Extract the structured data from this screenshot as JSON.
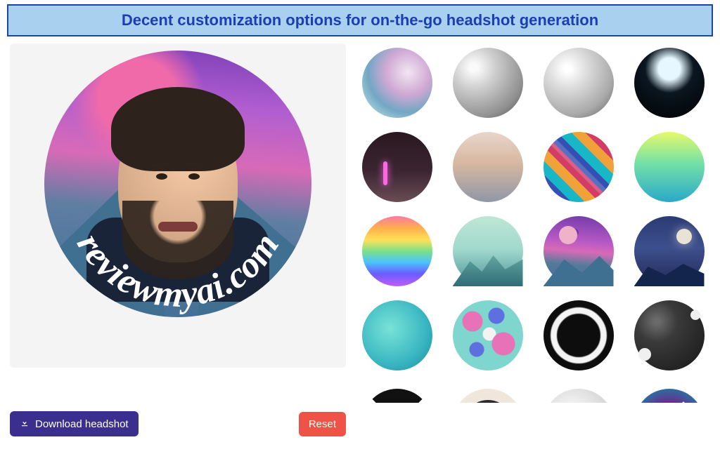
{
  "banner": {
    "title": "Decent customization options for on-the-go headshot generation"
  },
  "preview": {
    "watermark": "reviewmyai.com"
  },
  "actions": {
    "download_label": "Download headshot",
    "reset_label": "Reset"
  },
  "backgrounds": {
    "options": [
      {
        "name": "pastel-orbs"
      },
      {
        "name": "matte-sphere-dark"
      },
      {
        "name": "matte-sphere-light"
      },
      {
        "name": "ring-light-room"
      },
      {
        "name": "neon-bar"
      },
      {
        "name": "warm-haze"
      },
      {
        "name": "geometric-diagonal"
      },
      {
        "name": "lime-aqua-gradient"
      },
      {
        "name": "rainbow-bands"
      },
      {
        "name": "teal-mountains"
      },
      {
        "name": "purple-sunset-peaks"
      },
      {
        "name": "indigo-night-moon"
      },
      {
        "name": "aqua-sphere"
      },
      {
        "name": "mint-paint-splash"
      },
      {
        "name": "black-brush-ring"
      },
      {
        "name": "charcoal-vignette"
      },
      {
        "name": "bw-quadrant"
      },
      {
        "name": "cream-ink-ring"
      },
      {
        "name": "soft-grey-sphere"
      },
      {
        "name": "nebula-stars"
      }
    ]
  }
}
